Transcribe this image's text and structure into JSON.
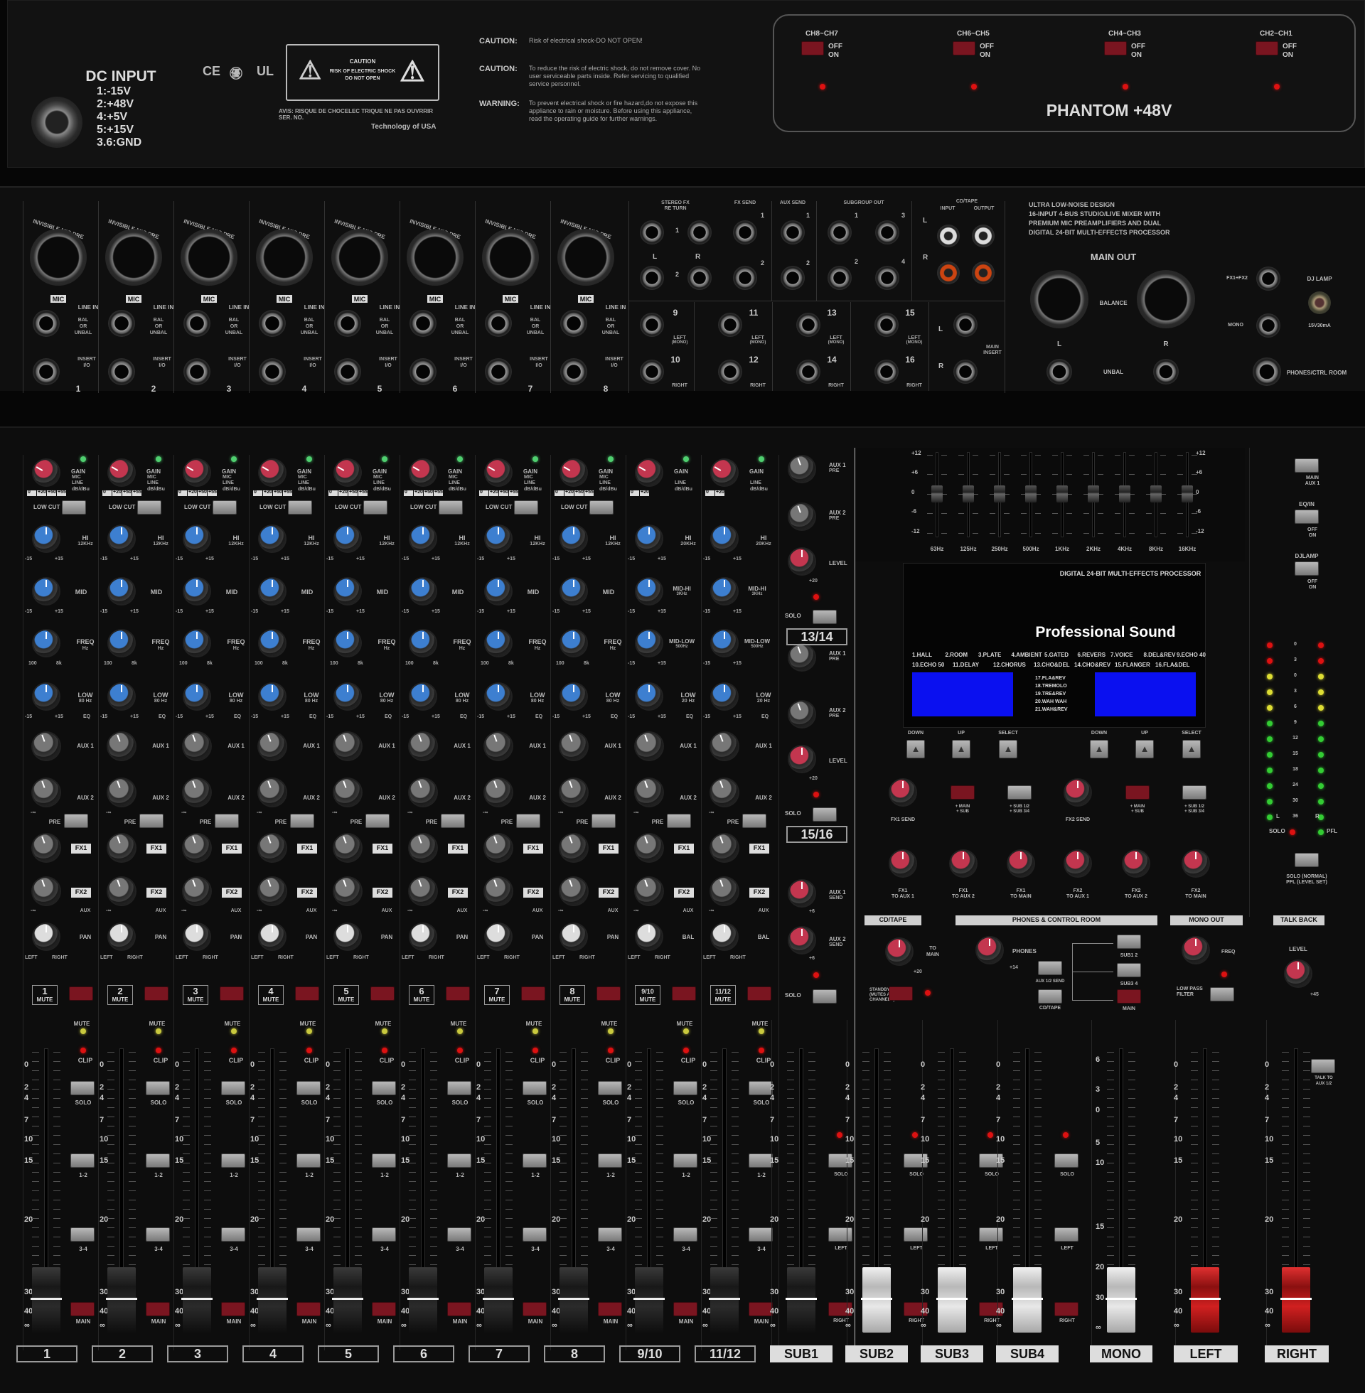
{
  "top": {
    "dc_input": {
      "title": "DC INPUT",
      "pins": [
        "1:-15V",
        "2:+48V",
        "4:+5V",
        "5:+15V",
        "3.6:GND"
      ]
    },
    "cert": [
      "CE",
      "㊝",
      "UL"
    ],
    "caution_label": {
      "title": "CAUTION",
      "line1": "RISK OF ELECTRIC SHOCK",
      "line2": "DO NOT OPEN"
    },
    "avis": [
      "AVIS: RISQUE DE CHOCELEC TRIQUE NE PAS OUVRRIR",
      "SER. NO."
    ],
    "technology": "Technology of USA",
    "warnings": [
      {
        "label": "CAUTION:",
        "text": [
          "Risk of electrical shock-DO NOT OPEN!"
        ]
      },
      {
        "label": "CAUTION:",
        "text": [
          "To reduce the risk of electric shock, do not remove cover. No",
          "user serviceable parts inside. Refer servicing to qualified",
          "service personnel."
        ]
      },
      {
        "label": "WARNING:",
        "text": [
          "To prevent electrical shock or fire hazard,do not expose this",
          "appliance to rain or moisture. Before using this appliance,",
          "read the operating guide for further warnings."
        ]
      }
    ],
    "phantom": {
      "title": "PHANTOM +48V",
      "off": "OFF",
      "on": "ON",
      "groups": [
        "CH8~CH7",
        "CH6~CH5",
        "CH4~CH3",
        "CH2~CH1"
      ]
    }
  },
  "rear": {
    "xlr_label": "INVISIBLE MIC PRE",
    "mic": "MIC",
    "line_in": "LINE IN",
    "bal": [
      "BAL",
      "OR",
      "UNBAL"
    ],
    "insert": [
      "INSERT",
      "I/O"
    ],
    "channels": [
      "1",
      "2",
      "3",
      "4",
      "5",
      "6",
      "7",
      "8"
    ],
    "stereo_fx_return": [
      "STEREO FX",
      "RE TURN"
    ],
    "fx_send": "FX SEND",
    "aux_send": "AUX SEND",
    "subgroup_out": "SUBGROUP OUT",
    "cd_tape": "CD/TAPE",
    "input": "INPUT",
    "output": "OUTPUT",
    "stereo_in": [
      {
        "top": "9",
        "bot": "10"
      },
      {
        "top": "11",
        "bot": "12"
      },
      {
        "top": "13",
        "bot": "14"
      },
      {
        "top": "15",
        "bot": "16"
      }
    ],
    "left_mono": [
      "LEFT",
      "(MONO)"
    ],
    "right": "RIGHT",
    "L": "L",
    "R": "R",
    "n1": "1",
    "n2": "2",
    "n3": "3",
    "n4": "4",
    "main_insert": [
      "MAIN",
      "INSERT"
    ],
    "desc": [
      "ULTRA LOW-NOISE DESIGN",
      "16-INPUT 4-BUS STUDIO/LIVE MIXER WITH",
      "PREMIUM MIC PREAMPLIFIERS AND DUAL",
      "DIGITAL 24-BIT MULTI-EFFECTS PROCESSOR"
    ],
    "main_out": "MAIN OUT",
    "balance": "BALANCE",
    "unbal": "UNBAL",
    "fx12": "FX1+FX2",
    "mono": "MONO",
    "dj_lamp": "DJ LAMP",
    "dj_spec": "15V30mA",
    "phones": "PHONES/CTRL ROOM"
  },
  "strip": {
    "gain": "GAIN",
    "gain_sub": [
      "MIC",
      "LINE",
      "dB/dBu"
    ],
    "gain_scale": [
      "0",
      "+20",
      "+50",
      "+55"
    ],
    "gain_scale_st": [
      "0",
      "+20"
    ],
    "low_cut": "LOW CUT",
    "hi": [
      "HI",
      "12KHz"
    ],
    "hi_st": [
      "HI",
      "20KHz"
    ],
    "mid": "MID",
    "freq": [
      "FREQ",
      "Hz"
    ],
    "mid_hi": [
      "MID-HI",
      "3KHz"
    ],
    "mid_low": [
      "MID-LOW",
      "500Hz"
    ],
    "low": [
      "LOW",
      "80 Hz"
    ],
    "low_st": [
      "LOW",
      "20 Hz"
    ],
    "eq": "EQ",
    "aux1": "AUX 1",
    "aux2": "AUX 2",
    "pre": "PRE",
    "fx1": "FX1",
    "fx2": "FX2",
    "aux": "AUX",
    "pan": "PAN",
    "bal": "BAL",
    "left": "LEFT",
    "right": "RIGHT",
    "mute": "MUTE",
    "clip": "CLIP",
    "solo": "SOLO",
    "b12": "1-2",
    "b34": "3-4",
    "main": "MAIN",
    "pm15": [
      "-15",
      "+15"
    ],
    "freqsc": [
      "100",
      "8k"
    ],
    "inf": "-∞",
    "fader_scale": [
      "0",
      "2",
      "4",
      "7",
      "10",
      "15",
      "20",
      "30",
      "40",
      "∞"
    ],
    "names": [
      "1",
      "2",
      "3",
      "4",
      "5",
      "6",
      "7",
      "8",
      "9/10",
      "11/12"
    ]
  },
  "aux_returns": {
    "aux1_pre": [
      "AUX 1",
      "PRE"
    ],
    "aux2_pre": [
      "AUX 2",
      "PRE"
    ],
    "level": "LEVEL",
    "solo": "SOLO",
    "r1": "13/14",
    "r2": "15/16",
    "aux1_send": [
      "AUX 1",
      "SEND"
    ],
    "aux2_send": [
      "AUX 2",
      "SEND"
    ],
    "p20": "+20",
    "p6": "+6"
  },
  "eq": {
    "bands": [
      "63Hz",
      "125Hz",
      "250Hz",
      "500Hz",
      "1KHz",
      "2KHz",
      "4KHz",
      "8KHz",
      "16KHz"
    ],
    "levels": [
      0,
      0,
      0,
      0,
      0,
      0,
      0,
      0,
      0
    ],
    "scale": [
      "+12",
      "+6",
      "0",
      "-6",
      "-12"
    ]
  },
  "dsp": {
    "title": "DIGITAL 24-BIT MULTI-EFFECTS PROCESSOR",
    "brand": "Professional Sound",
    "row1": [
      "1.HALL",
      "2.ROOM",
      "3.PLATE",
      "4.AMBIENT",
      "5.GATED",
      "6.REVERS",
      "7.VOICE",
      "8.DEL&REV",
      "9.ECHO 40"
    ],
    "row2": [
      "10.ECHO 50",
      "11.DELAY",
      "12.CHORUS",
      "13.CHO&DEL",
      "14.CHO&REV",
      "15.FLANGER",
      "16.FLA&DEL"
    ],
    "mid": [
      "17.FLA&REV",
      "18.TREMOLO",
      "19.TRE&REV",
      "20.WAH WAH",
      "21.WAH&REV"
    ],
    "down": "DOWN",
    "up": "UP",
    "select": "SELECT",
    "fx1_send": "FX1 SEND",
    "fx2_send": "FX2 SEND",
    "main_sub": [
      "+ MAIN",
      "+ SUB"
    ],
    "sub_sub": [
      "+ SUB 1/2",
      "+ SUB 3/4"
    ],
    "fx_knobs": [
      [
        "FX1",
        "TO AUX 1"
      ],
      [
        "FX1",
        "TO AUX 2"
      ],
      [
        "FX1",
        "TO MAIN"
      ],
      [
        "FX2",
        "TO AUX 1"
      ],
      [
        "FX2",
        "TO AUX 2"
      ],
      [
        "FX2",
        "TO MAIN"
      ]
    ]
  },
  "sections": {
    "cd_tape": "CD/TAPE",
    "to_main": [
      "TO",
      "MAIN"
    ],
    "standby": [
      "STANDBY",
      "(MUTES ALL",
      "CHANNELS)"
    ],
    "phones_cr": "PHONES & CONTROL ROOM",
    "phones": "PHONES",
    "sub12": "SUB1 2",
    "sub34": "SUB3 4",
    "aux12send": "AUX 1/2 SEND",
    "cdtape": "CD/TAPE",
    "main": "MAIN",
    "mono_out": "MONO OUT",
    "freq": "FREQ",
    "lpf": [
      "LOW PASS",
      "FILTER"
    ],
    "talk_back": "TALK BACK",
    "level": "LEVEL",
    "talk_to": [
      "TALK TO",
      "AUX 1/2"
    ],
    "p14": "+14",
    "p20": "+20",
    "p45": "+45"
  },
  "right_col": {
    "main_aux1": [
      "MAIN",
      "AUX 1"
    ],
    "eq_in": "EQ/IN",
    "dj_lamp": "DJLAMP",
    "off": "OFF",
    "on": "ON",
    "solo": "SOLO",
    "pfl": "PFL",
    "solo_note": [
      "SOLO (NORMAL)",
      "PFL (LEVEL SET)"
    ],
    "meter": [
      "0",
      "3",
      "0",
      "3",
      "6",
      "9",
      "12",
      "15",
      "18",
      "24",
      "30",
      "36"
    ],
    "L": "L",
    "R": "R"
  },
  "bus": {
    "names": [
      "SUB1",
      "SUB2",
      "SUB3",
      "SUB4",
      "MONO",
      "LEFT",
      "RIGHT"
    ],
    "left": "LEFT",
    "right": "RIGHT",
    "solo": "SOLO",
    "mono_scale": [
      "6",
      "3",
      "0",
      "5",
      "10",
      "15",
      "20",
      "30",
      "∞"
    ]
  }
}
